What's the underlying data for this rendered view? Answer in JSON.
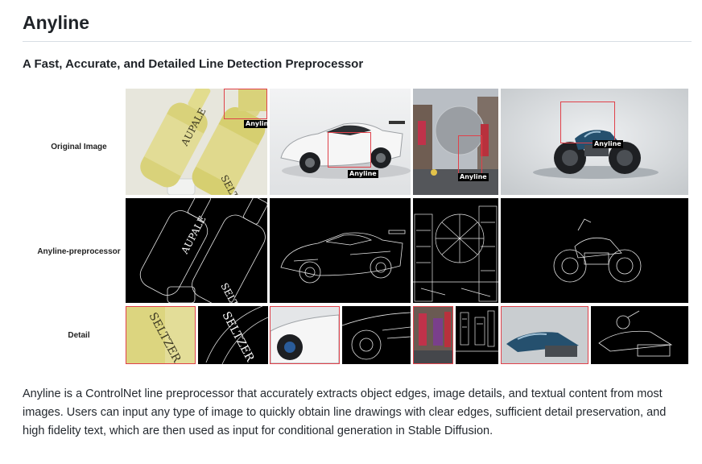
{
  "page": {
    "title": "Anyline",
    "subtitle": "A Fast, Accurate, and Detailed Line Detection Preprocessor",
    "description": "Anyline is a ControlNet line preprocessor that accurately extracts object edges, image details, and textual content from most images. Users can input any type of image to quickly obtain line drawings with clear edges, sufficient detail preservation, and high fidelity text, which are then used as input for conditional generation in Stable Diffusion."
  },
  "figure": {
    "row_labels": [
      "Original Image",
      "Anyline-preprocessor",
      "Detail"
    ],
    "box_tag": "Anyline",
    "bottle_text": [
      "AUPALE",
      "SELTZER"
    ],
    "detail_text": "SELTZER",
    "colors": {
      "box": "#e0414a",
      "tag_bg": "#000000",
      "edge_bg": "#000000"
    },
    "subjects": [
      "seltzer bottles",
      "white sports car",
      "city street with sphere building",
      "blue motorcycle"
    ]
  }
}
